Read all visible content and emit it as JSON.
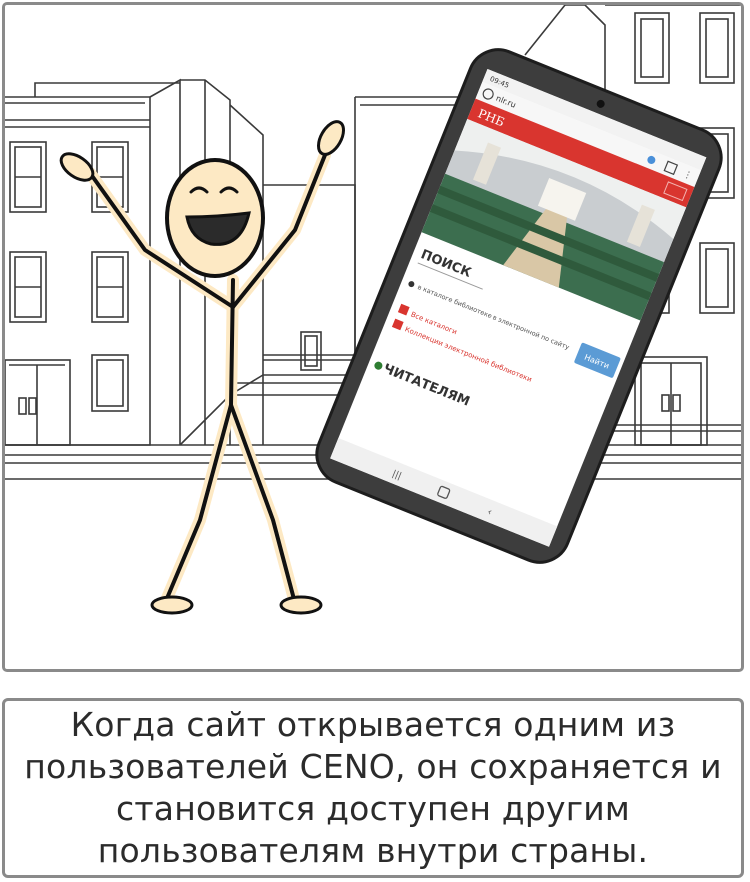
{
  "phone": {
    "clock": "09:45",
    "url": "nlr.ru",
    "site_logo": "РНБ",
    "search_heading": "ПОИСК",
    "option_catalog": "в каталоге библиотеке",
    "option_electronic": "в электронной по сайту",
    "search_button": "Найти",
    "link_all_catalogs": "Все каталоги",
    "link_collections": "Коллекции электронной библиотеки",
    "readers_heading": "ЧИТАТЕЛЯМ"
  },
  "caption": {
    "text": "Когда сайт открывается одним из пользователей CENO, он сохраняется и становится доступен другим пользователям внутри страны."
  },
  "colors": {
    "site_red": "#d9352f",
    "button_blue": "#5b9bd5",
    "figure_fill": "#fde9c4",
    "frame_gray": "#8a8a8a"
  }
}
